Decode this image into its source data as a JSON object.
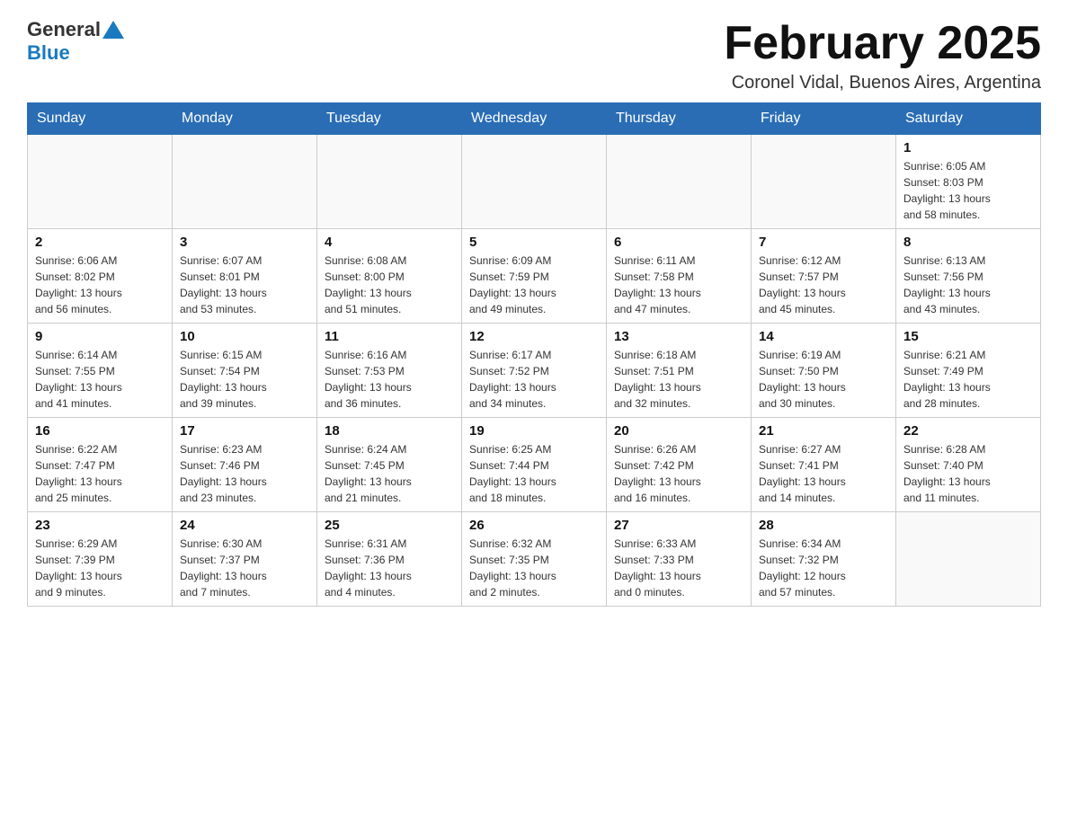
{
  "header": {
    "logo": {
      "part1": "General",
      "part2": "Blue"
    },
    "title": "February 2025",
    "location": "Coronel Vidal, Buenos Aires, Argentina"
  },
  "weekdays": [
    "Sunday",
    "Monday",
    "Tuesday",
    "Wednesday",
    "Thursday",
    "Friday",
    "Saturday"
  ],
  "weeks": [
    [
      {
        "day": "",
        "info": ""
      },
      {
        "day": "",
        "info": ""
      },
      {
        "day": "",
        "info": ""
      },
      {
        "day": "",
        "info": ""
      },
      {
        "day": "",
        "info": ""
      },
      {
        "day": "",
        "info": ""
      },
      {
        "day": "1",
        "info": "Sunrise: 6:05 AM\nSunset: 8:03 PM\nDaylight: 13 hours\nand 58 minutes."
      }
    ],
    [
      {
        "day": "2",
        "info": "Sunrise: 6:06 AM\nSunset: 8:02 PM\nDaylight: 13 hours\nand 56 minutes."
      },
      {
        "day": "3",
        "info": "Sunrise: 6:07 AM\nSunset: 8:01 PM\nDaylight: 13 hours\nand 53 minutes."
      },
      {
        "day": "4",
        "info": "Sunrise: 6:08 AM\nSunset: 8:00 PM\nDaylight: 13 hours\nand 51 minutes."
      },
      {
        "day": "5",
        "info": "Sunrise: 6:09 AM\nSunset: 7:59 PM\nDaylight: 13 hours\nand 49 minutes."
      },
      {
        "day": "6",
        "info": "Sunrise: 6:11 AM\nSunset: 7:58 PM\nDaylight: 13 hours\nand 47 minutes."
      },
      {
        "day": "7",
        "info": "Sunrise: 6:12 AM\nSunset: 7:57 PM\nDaylight: 13 hours\nand 45 minutes."
      },
      {
        "day": "8",
        "info": "Sunrise: 6:13 AM\nSunset: 7:56 PM\nDaylight: 13 hours\nand 43 minutes."
      }
    ],
    [
      {
        "day": "9",
        "info": "Sunrise: 6:14 AM\nSunset: 7:55 PM\nDaylight: 13 hours\nand 41 minutes."
      },
      {
        "day": "10",
        "info": "Sunrise: 6:15 AM\nSunset: 7:54 PM\nDaylight: 13 hours\nand 39 minutes."
      },
      {
        "day": "11",
        "info": "Sunrise: 6:16 AM\nSunset: 7:53 PM\nDaylight: 13 hours\nand 36 minutes."
      },
      {
        "day": "12",
        "info": "Sunrise: 6:17 AM\nSunset: 7:52 PM\nDaylight: 13 hours\nand 34 minutes."
      },
      {
        "day": "13",
        "info": "Sunrise: 6:18 AM\nSunset: 7:51 PM\nDaylight: 13 hours\nand 32 minutes."
      },
      {
        "day": "14",
        "info": "Sunrise: 6:19 AM\nSunset: 7:50 PM\nDaylight: 13 hours\nand 30 minutes."
      },
      {
        "day": "15",
        "info": "Sunrise: 6:21 AM\nSunset: 7:49 PM\nDaylight: 13 hours\nand 28 minutes."
      }
    ],
    [
      {
        "day": "16",
        "info": "Sunrise: 6:22 AM\nSunset: 7:47 PM\nDaylight: 13 hours\nand 25 minutes."
      },
      {
        "day": "17",
        "info": "Sunrise: 6:23 AM\nSunset: 7:46 PM\nDaylight: 13 hours\nand 23 minutes."
      },
      {
        "day": "18",
        "info": "Sunrise: 6:24 AM\nSunset: 7:45 PM\nDaylight: 13 hours\nand 21 minutes."
      },
      {
        "day": "19",
        "info": "Sunrise: 6:25 AM\nSunset: 7:44 PM\nDaylight: 13 hours\nand 18 minutes."
      },
      {
        "day": "20",
        "info": "Sunrise: 6:26 AM\nSunset: 7:42 PM\nDaylight: 13 hours\nand 16 minutes."
      },
      {
        "day": "21",
        "info": "Sunrise: 6:27 AM\nSunset: 7:41 PM\nDaylight: 13 hours\nand 14 minutes."
      },
      {
        "day": "22",
        "info": "Sunrise: 6:28 AM\nSunset: 7:40 PM\nDaylight: 13 hours\nand 11 minutes."
      }
    ],
    [
      {
        "day": "23",
        "info": "Sunrise: 6:29 AM\nSunset: 7:39 PM\nDaylight: 13 hours\nand 9 minutes."
      },
      {
        "day": "24",
        "info": "Sunrise: 6:30 AM\nSunset: 7:37 PM\nDaylight: 13 hours\nand 7 minutes."
      },
      {
        "day": "25",
        "info": "Sunrise: 6:31 AM\nSunset: 7:36 PM\nDaylight: 13 hours\nand 4 minutes."
      },
      {
        "day": "26",
        "info": "Sunrise: 6:32 AM\nSunset: 7:35 PM\nDaylight: 13 hours\nand 2 minutes."
      },
      {
        "day": "27",
        "info": "Sunrise: 6:33 AM\nSunset: 7:33 PM\nDaylight: 13 hours\nand 0 minutes."
      },
      {
        "day": "28",
        "info": "Sunrise: 6:34 AM\nSunset: 7:32 PM\nDaylight: 12 hours\nand 57 minutes."
      },
      {
        "day": "",
        "info": ""
      }
    ]
  ]
}
